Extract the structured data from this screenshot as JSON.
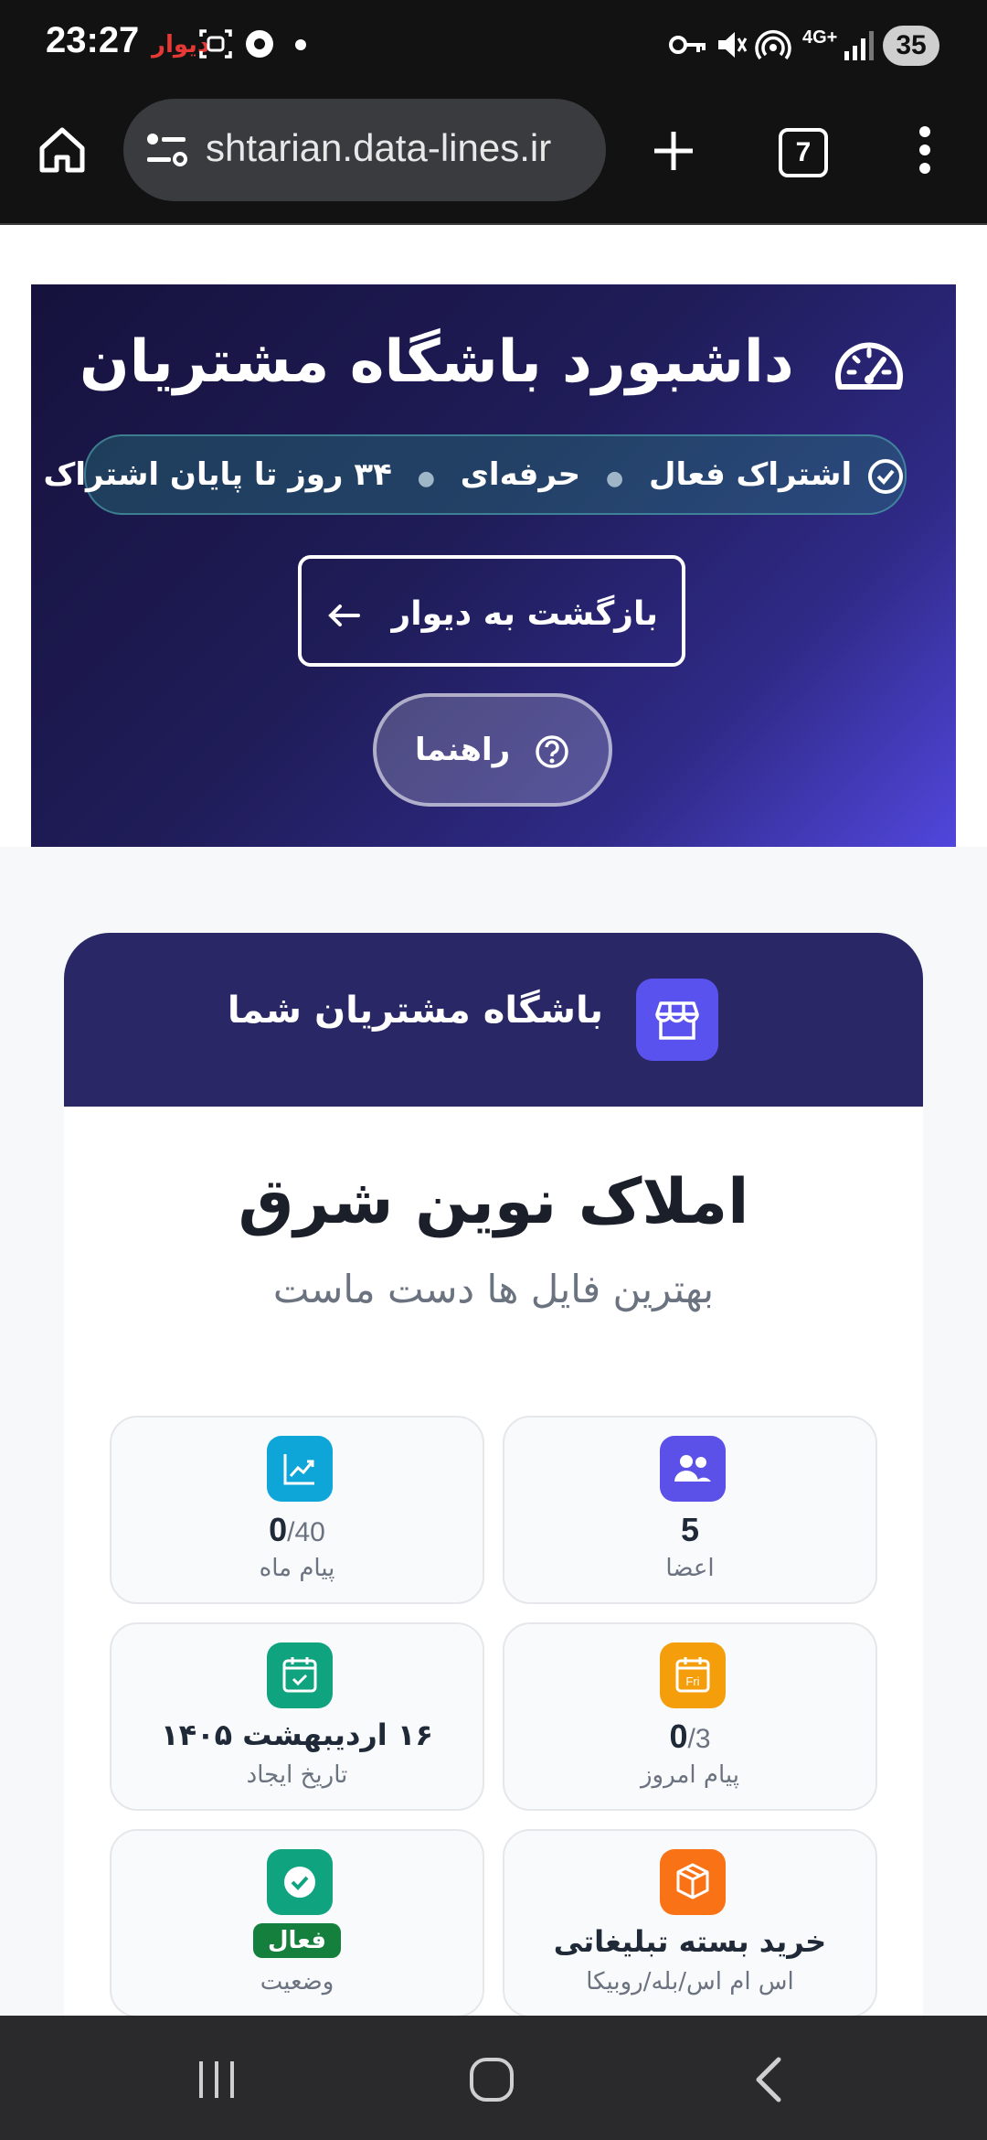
{
  "status_bar": {
    "time": "23:27",
    "app_label": "دیوار",
    "battery": "35",
    "network": "4G+"
  },
  "browser": {
    "url": "shtarian.data-lines.ir",
    "tab_count": "7"
  },
  "hero": {
    "title": "داشبورد باشگاه مشتریان",
    "subscription_status": "اشتراک فعال",
    "plan": "حرفه‌ای",
    "days_left": "۳۴ روز تا پایان اشتراک",
    "back_button": "بازگشت به دیوار",
    "help_button": "راهنما"
  },
  "club_card": {
    "header_title": "باشگاه مشتریان شما",
    "business_name": "املاک نوین شرق",
    "slogan": "بهترین فایل ها دست ماست"
  },
  "stats": {
    "members": {
      "value": "5",
      "label": "اعضا",
      "color": "#5b50e8"
    },
    "monthly_messages": {
      "used": "0",
      "limit": "/40",
      "label": "پیام ماه",
      "color": "#0ea5d9"
    },
    "today_messages": {
      "used": "0",
      "limit": "/3",
      "label": "پیام امروز",
      "color": "#f59e0b",
      "icon_text": "Fri"
    },
    "created": {
      "value": "۱۶ اردیبهشت ۱۴۰۵",
      "label": "تاریخ ایجاد",
      "color": "#10a37f"
    },
    "package": {
      "value": "خرید بسته تبلیغاتی",
      "label": "اس ام اس/بله/روبیکا",
      "color": "#f97316"
    },
    "status": {
      "value": "فعال",
      "label": "وضعیت",
      "color": "#10a37f"
    }
  }
}
